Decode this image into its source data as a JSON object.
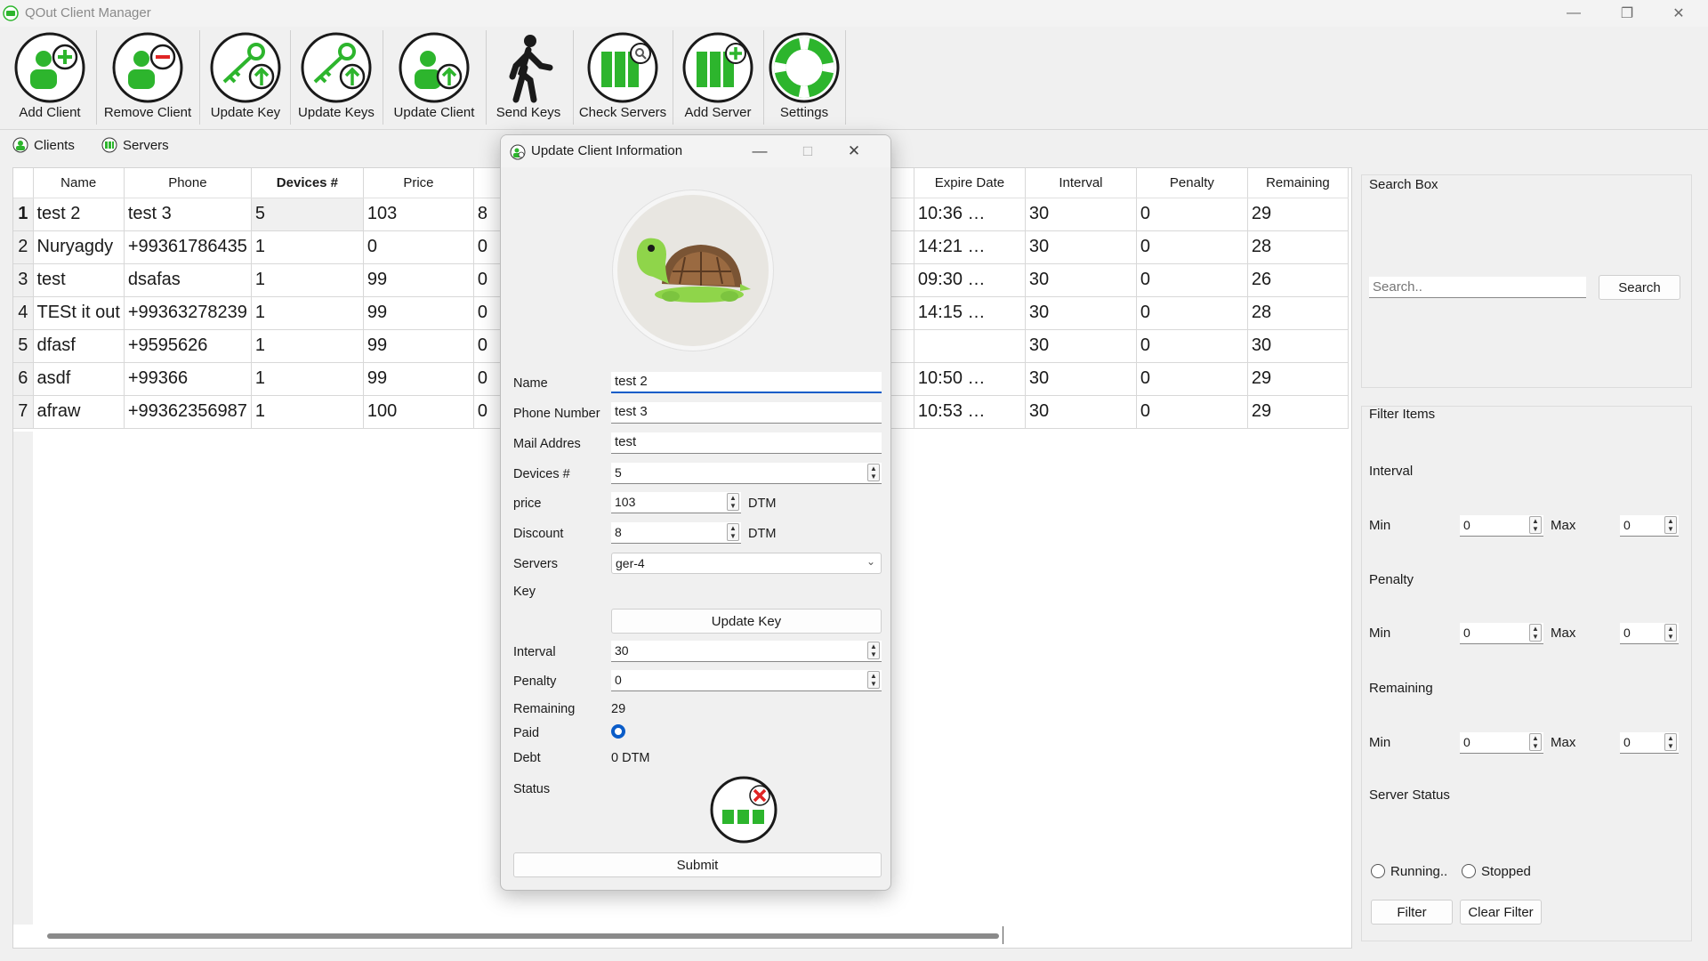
{
  "window": {
    "title": "QOut Client Manager"
  },
  "toolbar": {
    "items": [
      {
        "label": "Add Client",
        "icon": "add-client-icon"
      },
      {
        "label": "Remove Client",
        "icon": "remove-client-icon"
      },
      {
        "label": "Update Key",
        "icon": "update-key-icon"
      },
      {
        "label": "Update Keys",
        "icon": "update-keys-icon"
      },
      {
        "label": "Update Client",
        "icon": "update-client-icon"
      },
      {
        "label": "Send Keys",
        "icon": "walking-person-icon"
      },
      {
        "label": "Check Servers",
        "icon": "check-servers-icon"
      },
      {
        "label": "Add Server",
        "icon": "add-server-icon"
      },
      {
        "label": "Settings",
        "icon": "lifebuoy-icon"
      }
    ]
  },
  "tabs": [
    {
      "label": "Clients",
      "active": true
    },
    {
      "label": "Servers",
      "active": false
    }
  ],
  "table": {
    "columns": [
      "Name",
      "Phone",
      "Devices #",
      "Price",
      "Expire Date",
      "Interval",
      "Penalty",
      "Remaining"
    ],
    "rows": [
      {
        "n": "1",
        "name": "test 2",
        "phone": "test 3",
        "devices": "5",
        "price": "103",
        "discount": "8",
        "expire": "10:36 …",
        "interval": "30",
        "penalty": "0",
        "remaining": "29"
      },
      {
        "n": "2",
        "name": "Nuryagdy",
        "phone": "+99361786435",
        "devices": "1",
        "price": "0",
        "discount": "0",
        "expire": "14:21 …",
        "interval": "30",
        "penalty": "0",
        "remaining": "28"
      },
      {
        "n": "3",
        "name": "test",
        "phone": "dsafas",
        "devices": "1",
        "price": "99",
        "discount": "0",
        "expire": "09:30 …",
        "interval": "30",
        "penalty": "0",
        "remaining": "26"
      },
      {
        "n": "4",
        "name": "TESt it out",
        "phone": "+99363278239",
        "devices": "1",
        "price": "99",
        "discount": "0",
        "expire": "14:15 …",
        "interval": "30",
        "penalty": "0",
        "remaining": "28"
      },
      {
        "n": "5",
        "name": "dfasf",
        "phone": "+9595626",
        "devices": "1",
        "price": "99",
        "discount": "0",
        "expire": "",
        "interval": "30",
        "penalty": "0",
        "remaining": "30"
      },
      {
        "n": "6",
        "name": "asdf",
        "phone": "+99366",
        "devices": "1",
        "price": "99",
        "discount": "0",
        "expire": "10:50 …",
        "interval": "30",
        "penalty": "0",
        "remaining": "29"
      },
      {
        "n": "7",
        "name": "afraw",
        "phone": "+99362356987",
        "devices": "1",
        "price": "100",
        "discount": "0",
        "expire": "10:53 …",
        "interval": "30",
        "penalty": "0",
        "remaining": "29"
      }
    ]
  },
  "search_box": {
    "title": "Search Box",
    "placeholder": "Search..",
    "button": "Search"
  },
  "filter": {
    "title": "Filter Items",
    "interval": {
      "label": "Interval",
      "min_label": "Min",
      "max_label": "Max",
      "min": "0",
      "max": "0"
    },
    "penalty": {
      "label": "Penalty",
      "min_label": "Min",
      "max_label": "Max",
      "min": "0",
      "max": "0"
    },
    "remaining": {
      "label": "Remaining",
      "min_label": "Min",
      "max_label": "Max",
      "min": "0",
      "max": "0"
    },
    "server_status": {
      "label": "Server Status",
      "running": "Running..",
      "stopped": "Stopped"
    },
    "filter_button": "Filter",
    "clear_button": "Clear Filter"
  },
  "dialog": {
    "title": "Update Client Information",
    "name": {
      "label": "Name",
      "value": "test 2"
    },
    "phone": {
      "label": "Phone Number",
      "value": "test 3"
    },
    "mail": {
      "label": "Mail Addres",
      "value": "test"
    },
    "devices": {
      "label": "Devices #",
      "value": "5"
    },
    "price": {
      "label": "price",
      "value": "103",
      "unit": "DTM"
    },
    "discount": {
      "label": "Discount",
      "value": "8",
      "unit": "DTM"
    },
    "servers": {
      "label": "Servers",
      "value": "ger-4"
    },
    "key": {
      "label": "Key"
    },
    "update_key_button": "Update Key",
    "interval": {
      "label": "Interval",
      "value": "30"
    },
    "penalty": {
      "label": "Penalty",
      "value": "0"
    },
    "remaining": {
      "label": "Remaining",
      "value": "29"
    },
    "paid": {
      "label": "Paid",
      "checked": true
    },
    "debt": {
      "label": "Debt",
      "value": "0 DTM"
    },
    "status": {
      "label": "Status",
      "icon": "server-stopped-icon"
    },
    "submit_button": "Submit"
  },
  "colors": {
    "accent_green": "#2db52d",
    "dark": "#1a1a1a",
    "error_red": "#e02424",
    "radio_blue": "#0a5cc8"
  }
}
